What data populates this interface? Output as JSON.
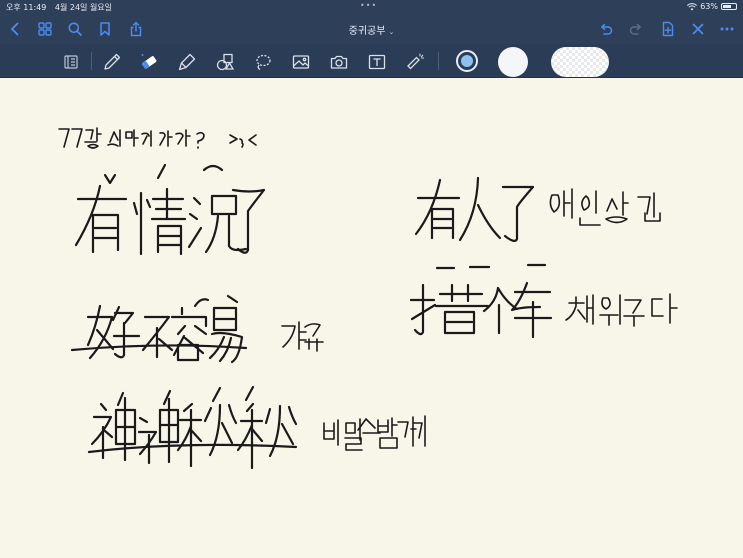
{
  "status": {
    "time": "오후 11:49",
    "date": "4월 24일 월요일",
    "battery": "63%",
    "battery_level": 0.63
  },
  "document": {
    "title": "중귀공부"
  },
  "colors": {
    "bar": "#2e3f5a",
    "accent": "#4a8cf0",
    "paper": "#f8f5e9",
    "ink": "#1a1a1a"
  },
  "nav_icons": [
    "chevron-left-icon",
    "grid-icon",
    "search-icon",
    "bookmark-icon",
    "share-icon",
    "undo-icon",
    "redo-icon",
    "add-page-icon",
    "close-icon",
    "more-icon"
  ],
  "tools": [
    "page-layout-icon",
    "pen-icon",
    "eraser-icon",
    "highlighter-icon",
    "shapes-icon",
    "lasso-icon",
    "image-icon",
    "camera-icon",
    "text-icon",
    "laser-pointer-icon"
  ],
  "selected_tool": "eraser-icon"
}
